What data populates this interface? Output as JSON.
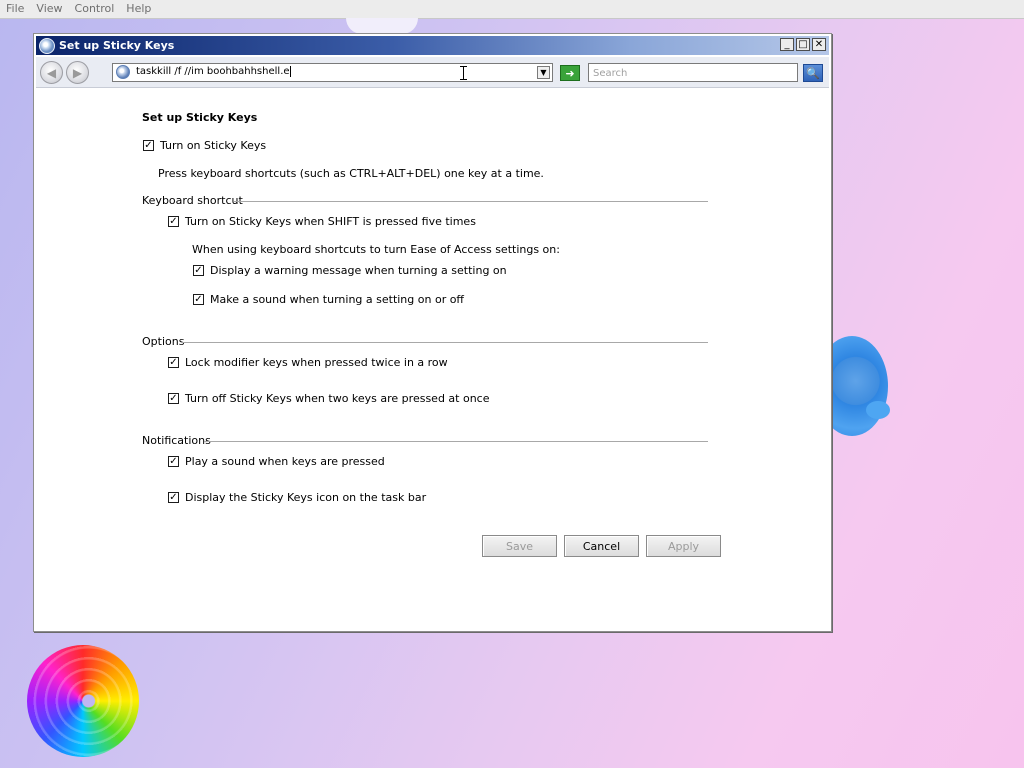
{
  "menubar": {
    "items": [
      "File",
      "View",
      "Control",
      "Help"
    ]
  },
  "window": {
    "title": "Set up Sticky Keys",
    "controls": {
      "minimize": "_",
      "maximize": "□",
      "close": "✕"
    }
  },
  "toolbar": {
    "back_icon": "back-arrow-icon",
    "forward_icon": "forward-arrow-icon",
    "address_value": "taskkill /f //im boohbahhshell.e",
    "dropdown_glyph": "▼",
    "go_glyph": "➜",
    "search_placeholder": "Search",
    "search_glyph": "🔍"
  },
  "page": {
    "heading": "Set up Sticky Keys",
    "turn_on": {
      "label": "Turn on Sticky Keys",
      "checked": true
    },
    "turn_on_desc": "Press keyboard shortcuts (such as CTRL+ALT+DEL) one key at a time.",
    "keyboard_shortcut": {
      "title": "Keyboard shortcut",
      "shift_five": {
        "label": "Turn on Sticky Keys when SHIFT is pressed five times",
        "checked": true
      },
      "subheading": "When using keyboard shortcuts to turn Ease of Access settings on:",
      "warning": {
        "label": "Display a warning message when turning a setting on",
        "checked": true
      },
      "sound": {
        "label": "Make a sound when turning a setting on or off",
        "checked": true
      }
    },
    "options": {
      "title": "Options",
      "lock_modifier": {
        "label": "Lock modifier keys when pressed twice in a row",
        "checked": true
      },
      "turn_off_two": {
        "label": "Turn off Sticky Keys when two keys are pressed at once",
        "checked": true
      }
    },
    "notifications": {
      "title": "Notifications",
      "play_sound": {
        "label": "Play a sound when keys are pressed",
        "checked": true
      },
      "taskbar_icon": {
        "label": "Display the Sticky Keys icon on the task bar",
        "checked": true
      }
    },
    "buttons": {
      "save": "Save",
      "cancel": "Cancel",
      "apply": "Apply"
    },
    "check_glyph": "✓"
  },
  "colors": {
    "titlebar_start": "#0b246a",
    "titlebar_end": "#b5c7e8",
    "go_button": "#3aa33a",
    "search_button": "#2f63b8"
  }
}
